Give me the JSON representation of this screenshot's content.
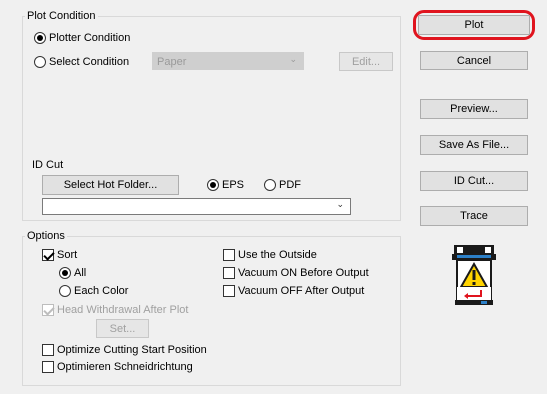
{
  "plot_condition": {
    "title": "Plot Condition",
    "plotter_condition_label": "Plotter Condition",
    "select_condition_label": "Select Condition",
    "condition_value": "Paper",
    "edit_label": "Edit..."
  },
  "id_cut": {
    "label": "ID Cut",
    "select_hot_folder_label": "Select Hot Folder...",
    "eps_label": "EPS",
    "pdf_label": "PDF",
    "folder_value": ""
  },
  "options": {
    "title": "Options",
    "sort_label": "Sort",
    "all_label": "All",
    "each_color_label": "Each Color",
    "head_withdrawal_label": "Head Withdrawal After Plot",
    "set_label": "Set...",
    "optimize_start_label": "Optimize Cutting Start Position",
    "optimieren_label": "Optimieren Schneidrichtung",
    "use_outside_label": "Use the Outside",
    "vacuum_on_label": "Vacuum ON Before Output",
    "vacuum_off_label": "Vacuum OFF After Output"
  },
  "buttons": {
    "plot": "Plot",
    "cancel": "Cancel",
    "preview": "Preview...",
    "save_as_file": "Save As File...",
    "id_cut": "ID Cut...",
    "trace": "Trace"
  },
  "icons": {
    "plotter_warning": "plotter-warning-icon",
    "chevron": "chevron-down-icon"
  },
  "colors": {
    "highlight": "#e0141e",
    "warning_yellow": "#ffd400"
  }
}
